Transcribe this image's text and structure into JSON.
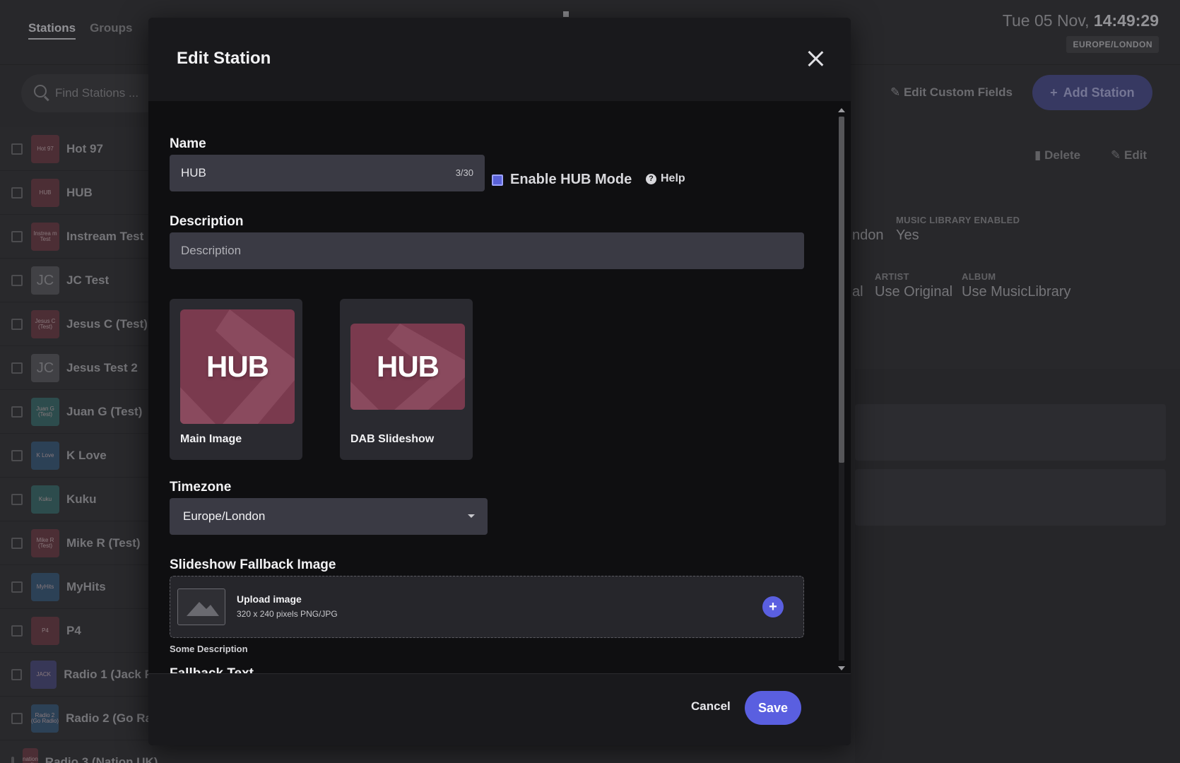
{
  "background": {
    "tabs": [
      {
        "label": "Stations"
      },
      {
        "label": "Groups"
      }
    ],
    "clock": {
      "date": "Tue 05 Nov,",
      "time": "14:49:29",
      "timezone": "EUROPE/LONDON"
    },
    "search": {
      "placeholder": "Find Stations ..."
    },
    "edit_custom_fields": "Edit Custom Fields",
    "add_station": "Add Station",
    "delete": "Delete",
    "edit": "Edit",
    "meta": {
      "timezone_partial": "ndon",
      "music_library_enabled_label": "MUSIC LIBRARY ENABLED",
      "music_library_enabled_value": "Yes",
      "partial_value": "al",
      "artist_label": "ARTIST",
      "artist_value": "Use Original",
      "album_label": "ALBUM",
      "album_value": "Use MusicLibrary"
    },
    "stations": [
      {
        "name": "Hot 97",
        "thumb": "Hot 97"
      },
      {
        "name": "HUB",
        "thumb": "HUB"
      },
      {
        "name": "Instream Test",
        "thumb": "Instrea m Test"
      },
      {
        "name": "JC Test",
        "thumb": "JC"
      },
      {
        "name": "Jesus C (Test)",
        "thumb": "Jesus C (Test)"
      },
      {
        "name": "Jesus Test 2",
        "thumb": "JC"
      },
      {
        "name": "Juan G (Test)",
        "thumb": "Juan G (Test)"
      },
      {
        "name": "K Love",
        "thumb": "K Love"
      },
      {
        "name": "Kuku",
        "thumb": "Kuku"
      },
      {
        "name": "Mike R (Test)",
        "thumb": "Mike R (Test)"
      },
      {
        "name": "MyHits",
        "thumb": "MyHits"
      },
      {
        "name": "P4",
        "thumb": "P4"
      },
      {
        "name": "Radio 1 (Jack F",
        "thumb": "JACK"
      },
      {
        "name": "Radio 2 (Go Ra",
        "thumb": "Radio 2 (Go Radio)"
      },
      {
        "name": "Radio 3 (Nation UK)",
        "thumb": "nation radio"
      }
    ]
  },
  "modal": {
    "title": "Edit Station",
    "name_label": "Name",
    "name_value": "HUB",
    "name_counter": "3/30",
    "enable_hub_mode": "Enable HUB Mode",
    "help": "Help",
    "description_label": "Description",
    "description_placeholder": "Description",
    "main_image": {
      "logo_text": "HUB",
      "caption": "Main Image"
    },
    "dab_slideshow": {
      "logo_text": "HUB",
      "caption": "DAB Slideshow"
    },
    "timezone_label": "Timezone",
    "timezone_value": "Europe/London",
    "fallback_image_label": "Slideshow Fallback Image",
    "upload_title": "Upload image",
    "upload_hint": "320 x 240 pixels PNG/JPG",
    "some_description": "Some Description",
    "fallback_text_label": "Fallback Text",
    "cancel": "Cancel",
    "save": "Save"
  },
  "colors": {
    "accent": "#5a5fe0",
    "modal_bg": "#0f0f11",
    "input_bg": "#3a3a44",
    "hub_brand": "#7a3a4e"
  }
}
